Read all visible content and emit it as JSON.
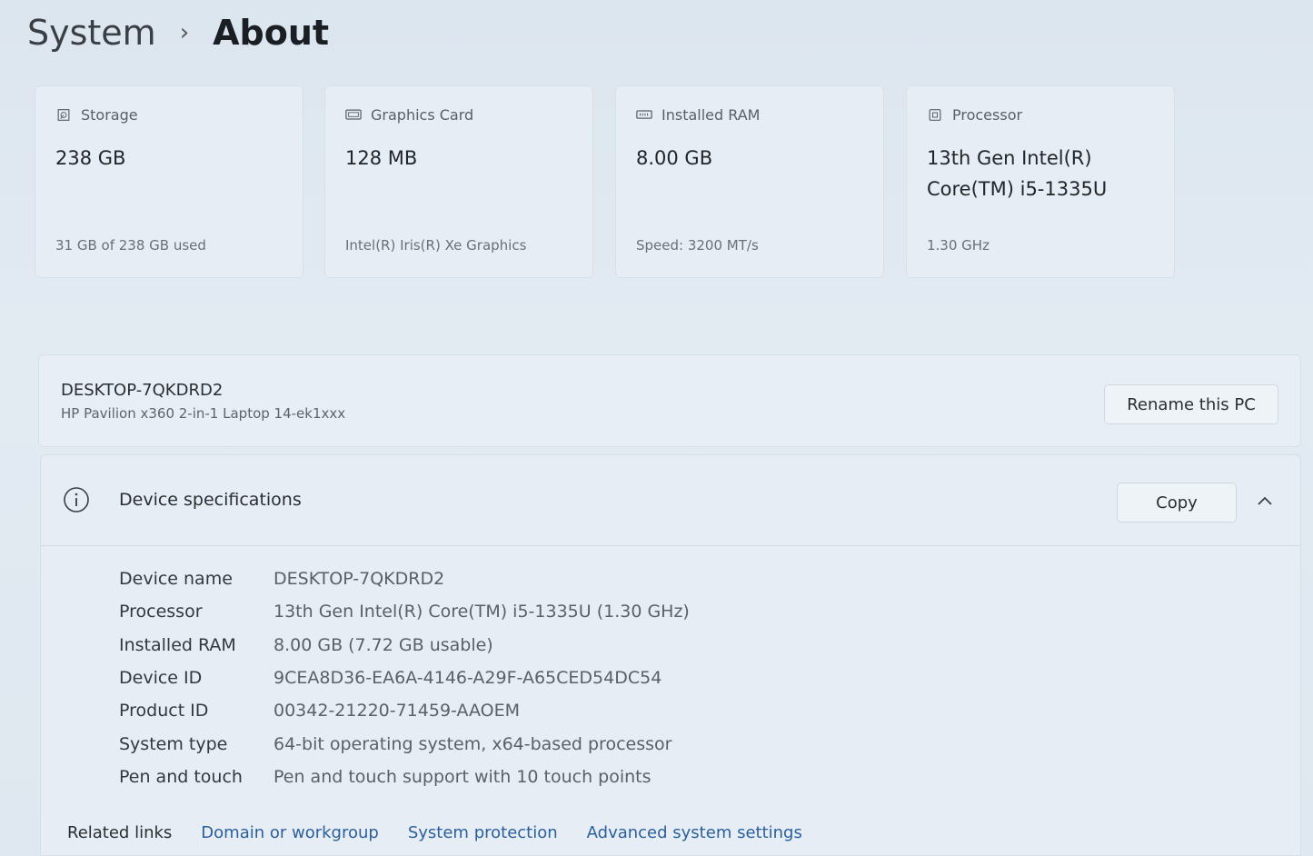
{
  "breadcrumb": {
    "parent": "System",
    "separator": "›",
    "current": "About"
  },
  "cards": [
    {
      "label": "Storage",
      "value": "238 GB",
      "sub": "31 GB of 238 GB used",
      "icon": "storage-icon"
    },
    {
      "label": "Graphics Card",
      "value": "128 MB",
      "sub": "Intel(R) Iris(R) Xe Graphics",
      "icon": "graphics-card-icon"
    },
    {
      "label": "Installed RAM",
      "value": "8.00 GB",
      "sub": "Speed: 3200 MT/s",
      "icon": "ram-icon"
    },
    {
      "label": "Processor",
      "value": "13th Gen Intel(R) Core(TM) i5-1335U",
      "sub": "1.30 GHz",
      "icon": "processor-icon"
    }
  ],
  "pc": {
    "name": "DESKTOP-7QKDRD2",
    "model": "HP Pavilion x360 2-in-1 Laptop 14-ek1xxx",
    "rename_label": "Rename this PC"
  },
  "specs": {
    "title": "Device specifications",
    "copy_label": "Copy",
    "rows": [
      {
        "key": "Device name",
        "value": "DESKTOP-7QKDRD2"
      },
      {
        "key": "Processor",
        "value": "13th Gen Intel(R) Core(TM) i5-1335U (1.30 GHz)"
      },
      {
        "key": "Installed RAM",
        "value": "8.00 GB (7.72 GB usable)"
      },
      {
        "key": "Device ID",
        "value": "9CEA8D36-EA6A-4146-A29F-A65CED54DC54"
      },
      {
        "key": "Product ID",
        "value": "00342-21220-71459-AAOEM"
      },
      {
        "key": "System type",
        "value": "64-bit operating system, x64-based processor"
      },
      {
        "key": "Pen and touch",
        "value": "Pen and touch support with 10 touch points"
      }
    ]
  },
  "related": {
    "title": "Related links",
    "links": [
      "Domain or workgroup",
      "System protection",
      "Advanced system settings"
    ]
  }
}
